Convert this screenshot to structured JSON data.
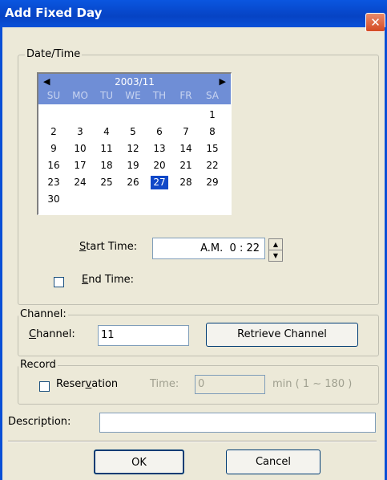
{
  "window": {
    "title": "Add Fixed Day",
    "close_icon": "✕"
  },
  "datetime": {
    "legend": "Date/Time",
    "calendar": {
      "month_label": "2003/11",
      "prev_icon": "◀",
      "next_icon": "▶",
      "weekdays": [
        "SU",
        "MO",
        "TU",
        "WE",
        "TH",
        "FR",
        "SA"
      ],
      "weeks": [
        [
          "",
          "",
          "",
          "",
          "",
          "",
          "1"
        ],
        [
          "2",
          "3",
          "4",
          "5",
          "6",
          "7",
          "8"
        ],
        [
          "9",
          "10",
          "11",
          "12",
          "13",
          "14",
          "15"
        ],
        [
          "16",
          "17",
          "18",
          "19",
          "20",
          "21",
          "22"
        ],
        [
          "23",
          "24",
          "25",
          "26",
          "27",
          "28",
          "29"
        ],
        [
          "30",
          "",
          "",
          "",
          "",
          "",
          ""
        ]
      ],
      "selected_day": "27"
    },
    "start_time_label_mnemonic": "S",
    "start_time_label_rest": "tart Time:",
    "start_time_value": "A.M.  0 : 22",
    "end_time_label_mnemonic": "E",
    "end_time_label_rest": "nd Time:",
    "end_time_checked": false
  },
  "channel": {
    "legend": "Channel:",
    "label_mnemonic": "C",
    "label_rest": "hannel:",
    "value": "11",
    "retrieve_button": "Retrieve Channel"
  },
  "record": {
    "legend": "Record",
    "reservation_label_pre": "Reser",
    "reservation_mnemonic": "v",
    "reservation_label_post": "ation",
    "reservation_checked": false,
    "time_label": "Time:",
    "time_value": "0",
    "time_hint": "min ( 1 ~ 180 )"
  },
  "description": {
    "label": "Description:",
    "value": ""
  },
  "buttons": {
    "ok": "OK",
    "cancel": "Cancel"
  }
}
